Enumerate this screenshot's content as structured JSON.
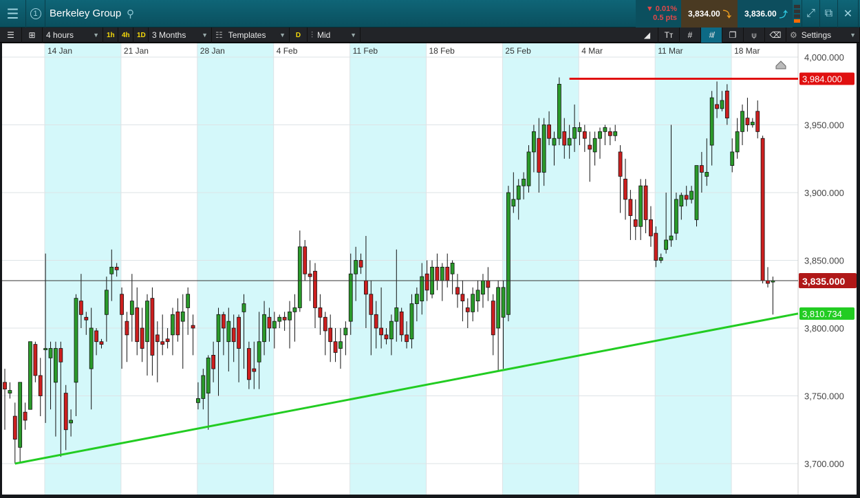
{
  "header": {
    "title": "Berkeley Group",
    "change_pct": "0.01%",
    "change_pts": "0.5 pts",
    "sell": "3,834.00",
    "buy": "3,836.00",
    "badge": "1"
  },
  "toolbar": {
    "interval": "4 hours",
    "q1": "1h",
    "q2": "4h",
    "q3": "1D",
    "range": "3 Months",
    "templates": "Templates",
    "d": "D",
    "price_type": "Mid",
    "settings": "Settings",
    "tools": [
      "draw-line",
      "text",
      "grid",
      "crosshair",
      "layers",
      "indicator",
      "tag"
    ]
  },
  "colors": {
    "up": "#2a9a2a",
    "down": "#cc1f1f",
    "trend": "#22cc22",
    "resistance": "#e01010",
    "band": "#d4f8fa"
  },
  "chart_data": {
    "type": "candlestick",
    "x_labels": [
      "14 Jan",
      "21 Jan",
      "28 Jan",
      "4 Feb",
      "11 Feb",
      "18 Feb",
      "25 Feb",
      "4 Mar",
      "11 Mar",
      "18 Mar"
    ],
    "y_ticks": [
      "4,000.000",
      "3,950.000",
      "3,900.000",
      "3,850.000",
      "3,800.000",
      "3,750.000",
      "3,700.000"
    ],
    "y_tick_values": [
      4000,
      3950,
      3900,
      3850,
      3800,
      3750,
      3700
    ],
    "ylim": [
      3695,
      4002
    ],
    "current_price": {
      "value": 3835,
      "label": "3,835.000"
    },
    "resistance": {
      "value": 3984,
      "label": "3,984.000",
      "start_index": 111
    },
    "trendline": {
      "start_price": 3700,
      "end_price": 3810.734,
      "label": "3,810.734"
    },
    "candles_per_week": 15,
    "candles": [
      [
        3760,
        3770,
        3725,
        3755
      ],
      [
        3752,
        3760,
        3748,
        3754
      ],
      [
        3735,
        3745,
        3700,
        3718
      ],
      [
        3712,
        3750,
        3700,
        3760
      ],
      [
        3738,
        3745,
        3725,
        3732
      ],
      [
        3740,
        3790,
        3745,
        3790
      ],
      [
        3788,
        3790,
        3760,
        3765
      ],
      [
        3765,
        3778,
        3735,
        3750
      ],
      [
        3785,
        3855,
        3730,
        3785
      ],
      [
        3778,
        3790,
        3740,
        3785
      ],
      [
        3760,
        3790,
        3720,
        3785
      ],
      [
        3785,
        3790,
        3705,
        3775
      ],
      [
        3752,
        3758,
        3710,
        3725
      ],
      [
        3730,
        3740,
        3720,
        3732
      ],
      [
        3760,
        3825,
        3735,
        3822
      ],
      [
        3820,
        3840,
        3800,
        3810
      ],
      [
        3808,
        3812,
        3795,
        3806
      ],
      [
        3770,
        3815,
        3740,
        3800
      ],
      [
        3798,
        3800,
        3780,
        3790
      ],
      [
        3790,
        3792,
        3785,
        3788
      ],
      [
        3810,
        3838,
        3790,
        3828
      ],
      [
        3840,
        3858,
        3820,
        3845
      ],
      [
        3845,
        3848,
        3838,
        3843
      ],
      [
        3825,
        3830,
        3770,
        3810
      ],
      [
        3805,
        3812,
        3775,
        3795
      ],
      [
        3810,
        3840,
        3790,
        3820
      ],
      [
        3815,
        3830,
        3780,
        3790
      ],
      [
        3800,
        3815,
        3775,
        3785
      ],
      [
        3790,
        3825,
        3765,
        3820
      ],
      [
        3822,
        3830,
        3765,
        3780
      ],
      [
        3795,
        3805,
        3760,
        3790
      ],
      [
        3790,
        3810,
        3780,
        3788
      ],
      [
        3792,
        3800,
        3785,
        3790
      ],
      [
        3795,
        3815,
        3780,
        3810
      ],
      [
        3812,
        3822,
        3790,
        3795
      ],
      [
        3805,
        3825,
        3770,
        3812
      ],
      [
        3815,
        3830,
        3795,
        3825
      ],
      [
        3802,
        3810,
        3780,
        3800
      ],
      [
        3745,
        3760,
        3740,
        3748
      ],
      [
        3748,
        3770,
        3740,
        3765
      ],
      [
        3752,
        3780,
        3725,
        3778
      ],
      [
        3780,
        3790,
        3760,
        3770
      ],
      [
        3790,
        3815,
        3750,
        3810
      ],
      [
        3810,
        3812,
        3780,
        3800
      ],
      [
        3790,
        3815,
        3768,
        3805
      ],
      [
        3800,
        3810,
        3775,
        3790
      ],
      [
        3808,
        3810,
        3760,
        3785
      ],
      [
        3812,
        3825,
        3770,
        3818
      ],
      [
        3785,
        3790,
        3755,
        3762
      ],
      [
        3770,
        3790,
        3755,
        3768
      ],
      [
        3775,
        3812,
        3755,
        3790
      ],
      [
        3790,
        3820,
        3780,
        3810
      ],
      [
        3808,
        3815,
        3790,
        3800
      ],
      [
        3800,
        3812,
        3785,
        3805
      ],
      [
        3805,
        3810,
        3800,
        3808
      ],
      [
        3808,
        3812,
        3798,
        3806
      ],
      [
        3806,
        3820,
        3785,
        3812
      ],
      [
        3812,
        3825,
        3790,
        3815
      ],
      [
        3815,
        3872,
        3812,
        3860
      ],
      [
        3860,
        3865,
        3835,
        3840
      ],
      [
        3840,
        3850,
        3820,
        3838
      ],
      [
        3842,
        3848,
        3800,
        3815
      ],
      [
        3815,
        3825,
        3795,
        3808
      ],
      [
        3808,
        3812,
        3780,
        3798
      ],
      [
        3800,
        3810,
        3775,
        3790
      ],
      [
        3790,
        3800,
        3775,
        3782
      ],
      [
        3785,
        3800,
        3770,
        3790
      ],
      [
        3795,
        3805,
        3780,
        3800
      ],
      [
        3805,
        3855,
        3795,
        3840
      ],
      [
        3840,
        3860,
        3820,
        3850
      ],
      [
        3850,
        3855,
        3840,
        3845
      ],
      [
        3835,
        3868,
        3800,
        3825
      ],
      [
        3825,
        3835,
        3780,
        3810
      ],
      [
        3810,
        3820,
        3785,
        3800
      ],
      [
        3800,
        3830,
        3785,
        3795
      ],
      [
        3795,
        3800,
        3788,
        3792
      ],
      [
        3792,
        3810,
        3780,
        3805
      ],
      [
        3805,
        3858,
        3790,
        3815
      ],
      [
        3812,
        3815,
        3790,
        3795
      ],
      [
        3795,
        3805,
        3785,
        3790
      ],
      [
        3792,
        3825,
        3785,
        3818
      ],
      [
        3818,
        3830,
        3805,
        3825
      ],
      [
        3820,
        3848,
        3810,
        3838
      ],
      [
        3840,
        3850,
        3820,
        3828
      ],
      [
        3825,
        3850,
        3822,
        3845
      ],
      [
        3845,
        3855,
        3828,
        3835
      ],
      [
        3835,
        3848,
        3820,
        3845
      ],
      [
        3845,
        3855,
        3830,
        3835
      ],
      [
        3840,
        3850,
        3825,
        3848
      ],
      [
        3830,
        3840,
        3815,
        3825
      ],
      [
        3825,
        3835,
        3805,
        3820
      ],
      [
        3815,
        3822,
        3800,
        3812
      ],
      [
        3812,
        3830,
        3805,
        3825
      ],
      [
        3820,
        3835,
        3812,
        3828
      ],
      [
        3825,
        3840,
        3815,
        3835
      ],
      [
        3835,
        3845,
        3820,
        3830
      ],
      [
        3820,
        3825,
        3780,
        3795
      ],
      [
        3800,
        3835,
        3768,
        3830
      ],
      [
        3808,
        3835,
        3770,
        3830
      ],
      [
        3810,
        3905,
        3805,
        3900
      ],
      [
        3890,
        3915,
        3885,
        3895
      ],
      [
        3895,
        3910,
        3880,
        3905
      ],
      [
        3905,
        3915,
        3895,
        3910
      ],
      [
        3905,
        3935,
        3900,
        3930
      ],
      [
        3930,
        3950,
        3915,
        3945
      ],
      [
        3940,
        3955,
        3900,
        3915
      ],
      [
        3915,
        3955,
        3905,
        3950
      ],
      [
        3950,
        3960,
        3935,
        3940
      ],
      [
        3935,
        3945,
        3920,
        3940
      ],
      [
        3940,
        3985,
        3935,
        3980
      ],
      [
        3945,
        3955,
        3925,
        3935
      ],
      [
        3935,
        3950,
        3925,
        3940
      ],
      [
        3940,
        3965,
        3930,
        3948
      ],
      [
        3945,
        3952,
        3935,
        3948
      ],
      [
        3945,
        3950,
        3930,
        3940
      ],
      [
        3935,
        3945,
        3908,
        3932
      ],
      [
        3930,
        3945,
        3920,
        3940
      ],
      [
        3940,
        3948,
        3925,
        3945
      ],
      [
        3945,
        3950,
        3935,
        3948
      ],
      [
        3945,
        3948,
        3935,
        3942
      ],
      [
        3942,
        3950,
        3938,
        3945
      ],
      [
        3930,
        3935,
        3885,
        3912
      ],
      [
        3910,
        3925,
        3880,
        3895
      ],
      [
        3895,
        3902,
        3865,
        3883
      ],
      [
        3880,
        3895,
        3865,
        3875
      ],
      [
        3875,
        3910,
        3865,
        3905
      ],
      [
        3905,
        3910,
        3870,
        3880
      ],
      [
        3880,
        3890,
        3860,
        3868
      ],
      [
        3870,
        3875,
        3845,
        3850
      ],
      [
        3850,
        3855,
        3848,
        3852
      ],
      [
        3858,
        3900,
        3855,
        3865
      ],
      [
        3865,
        3950,
        3860,
        3868
      ],
      [
        3870,
        3900,
        3865,
        3895
      ],
      [
        3890,
        3900,
        3880,
        3898
      ],
      [
        3898,
        3905,
        3890,
        3895
      ],
      [
        3895,
        3905,
        3892,
        3901
      ],
      [
        3880,
        3920,
        3875,
        3920
      ],
      [
        3920,
        3930,
        3900,
        3915
      ],
      [
        3912,
        3940,
        3905,
        3915
      ],
      [
        3935,
        3975,
        3920,
        3970
      ],
      [
        3965,
        3982,
        3955,
        3962
      ],
      [
        3962,
        3975,
        3960,
        3968
      ],
      [
        3975,
        3980,
        3950,
        3955
      ],
      [
        3920,
        3940,
        3915,
        3930
      ],
      [
        3930,
        3955,
        3925,
        3945
      ],
      [
        3945,
        3965,
        3935,
        3960
      ],
      [
        3955,
        3970,
        3945,
        3950
      ],
      [
        3950,
        3955,
        3948,
        3952
      ],
      [
        3960,
        3968,
        3940,
        3945
      ],
      [
        3940,
        3942,
        3833,
        3835
      ],
      [
        3835,
        3845,
        3830,
        3833
      ],
      [
        3835,
        3838,
        3810,
        3835
      ]
    ]
  }
}
